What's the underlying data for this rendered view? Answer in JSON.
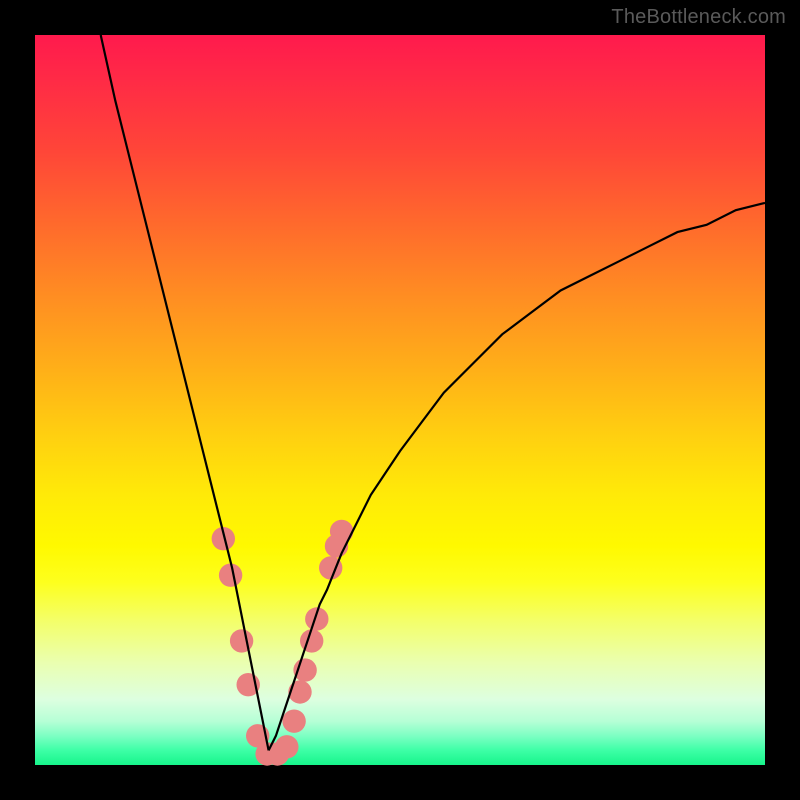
{
  "watermark": "TheBottleneck.com",
  "chart_data": {
    "type": "line",
    "title": "",
    "xlabel": "",
    "ylabel": "",
    "xlim": [
      0,
      100
    ],
    "ylim": [
      0,
      100
    ],
    "series": [
      {
        "name": "curve-left",
        "x": [
          9,
          11,
          13,
          15,
          17,
          19,
          20,
          21,
          22,
          23,
          24,
          25,
          26,
          27,
          28,
          29,
          30,
          31,
          32
        ],
        "values": [
          100,
          91,
          83,
          75,
          67,
          59,
          55,
          51,
          47,
          43,
          39,
          35,
          31,
          27,
          22,
          17,
          12,
          7,
          2
        ]
      },
      {
        "name": "curve-right",
        "x": [
          32,
          33,
          34,
          35,
          36,
          37,
          38,
          39,
          40,
          42,
          44,
          46,
          48,
          50,
          53,
          56,
          60,
          64,
          68,
          72,
          76,
          80,
          84,
          88,
          92,
          96,
          100
        ],
        "values": [
          2,
          4,
          7,
          10,
          13,
          16,
          19,
          22,
          24,
          29,
          33,
          37,
          40,
          43,
          47,
          51,
          55,
          59,
          62,
          65,
          67,
          69,
          71,
          73,
          74,
          76,
          77
        ]
      }
    ],
    "markers": {
      "name": "highlighted-points",
      "color": "#e98080",
      "radius_pct": 1.6,
      "points": [
        {
          "x": 25.8,
          "y": 31
        },
        {
          "x": 26.8,
          "y": 26
        },
        {
          "x": 28.3,
          "y": 17
        },
        {
          "x": 29.2,
          "y": 11
        },
        {
          "x": 30.5,
          "y": 4
        },
        {
          "x": 31.8,
          "y": 1.5
        },
        {
          "x": 33.2,
          "y": 1.5
        },
        {
          "x": 34.5,
          "y": 2.5
        },
        {
          "x": 35.5,
          "y": 6
        },
        {
          "x": 36.3,
          "y": 10
        },
        {
          "x": 37.0,
          "y": 13
        },
        {
          "x": 37.9,
          "y": 17
        },
        {
          "x": 38.6,
          "y": 20
        },
        {
          "x": 40.5,
          "y": 27
        },
        {
          "x": 41.3,
          "y": 30
        },
        {
          "x": 42.0,
          "y": 32
        }
      ]
    },
    "gradient_stops": [
      {
        "pos": 0.0,
        "color": "#ff1a4d"
      },
      {
        "pos": 0.06,
        "color": "#ff2a46"
      },
      {
        "pos": 0.16,
        "color": "#ff4638"
      },
      {
        "pos": 0.26,
        "color": "#ff6a2c"
      },
      {
        "pos": 0.36,
        "color": "#ff8e22"
      },
      {
        "pos": 0.46,
        "color": "#ffb018"
      },
      {
        "pos": 0.55,
        "color": "#ffd010"
      },
      {
        "pos": 0.63,
        "color": "#ffea08"
      },
      {
        "pos": 0.7,
        "color": "#fff900"
      },
      {
        "pos": 0.75,
        "color": "#fdff1e"
      },
      {
        "pos": 0.8,
        "color": "#f4ff66"
      },
      {
        "pos": 0.86,
        "color": "#eaffb0"
      },
      {
        "pos": 0.91,
        "color": "#ddffe0"
      },
      {
        "pos": 0.94,
        "color": "#b6ffd6"
      },
      {
        "pos": 0.96,
        "color": "#7dffc3"
      },
      {
        "pos": 0.98,
        "color": "#3dffa6"
      },
      {
        "pos": 1.0,
        "color": "#17f58b"
      }
    ]
  }
}
